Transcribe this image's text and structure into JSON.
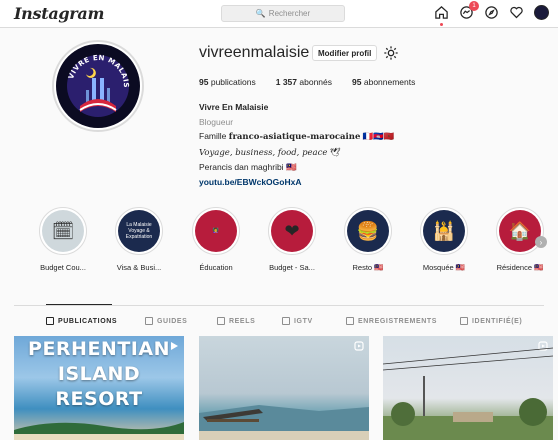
{
  "nav": {
    "logo": "Instagram",
    "search_placeholder": "Rechercher",
    "notification_count": "1"
  },
  "profile": {
    "username": "vivreenmalaisie",
    "edit_button": "Modifier profil",
    "stats": {
      "posts_count": "95",
      "posts_label": "publications",
      "followers_count": "1 357",
      "followers_label": "abonnés",
      "following_count": "95",
      "following_label": "abonnements"
    },
    "bio": {
      "name": "Vivre En Malaisie",
      "category": "Blogueur",
      "line1_prefix": "Famille",
      "line1_bold": "franco-asiatique-marocaine",
      "line1_flags": "🇫🇷🇰🇭🇲🇦",
      "line2": "Voyage, business, food, peace",
      "line2_emoji": "🕊",
      "line3": "Perancis dan maghribi",
      "line3_flag": "🇲🇾",
      "link": "youtu.be/EBWckOGoHxA"
    },
    "pic_text": "VIVRE EN MALAISIE.COM"
  },
  "highlights": [
    {
      "label": "Budget Cou...",
      "bg": "#cfd8dc",
      "glyph": "🗓"
    },
    {
      "label": "Visa & Busi...",
      "bg": "#1b2a4e",
      "glyph": "La Malaisie Voyage & Expatriation"
    },
    {
      "label": "Éducation",
      "bg": "#b71c3c",
      "glyph": "👩‍🏫"
    },
    {
      "label": "Budget - Sa...",
      "bg": "#b71c3c",
      "glyph": "❤"
    },
    {
      "label": "Resto 🇲🇾",
      "bg": "#1b2a4e",
      "glyph": "🍔"
    },
    {
      "label": "Mosquée 🇲🇾",
      "bg": "#1b2a4e",
      "glyph": "🕌"
    },
    {
      "label": "Résidence 🇲🇾",
      "bg": "#b71c3c",
      "glyph": "🏠"
    }
  ],
  "tabs": [
    {
      "label": "PUBLICATIONS",
      "active": true
    },
    {
      "label": "GUIDES"
    },
    {
      "label": "REELS"
    },
    {
      "label": "IGTV"
    },
    {
      "label": "ENREGISTREMENTS"
    },
    {
      "label": "IDENTIFIÉ(E)"
    }
  ],
  "posts": [
    {
      "text_lines": [
        "PERHENTIAN",
        "ISLAND",
        "RESORT"
      ],
      "type_icon": "play-icon"
    },
    {
      "text_lines": [],
      "type_icon": "reel-icon"
    },
    {
      "text_lines": [],
      "type_icon": "reel-icon"
    }
  ]
}
